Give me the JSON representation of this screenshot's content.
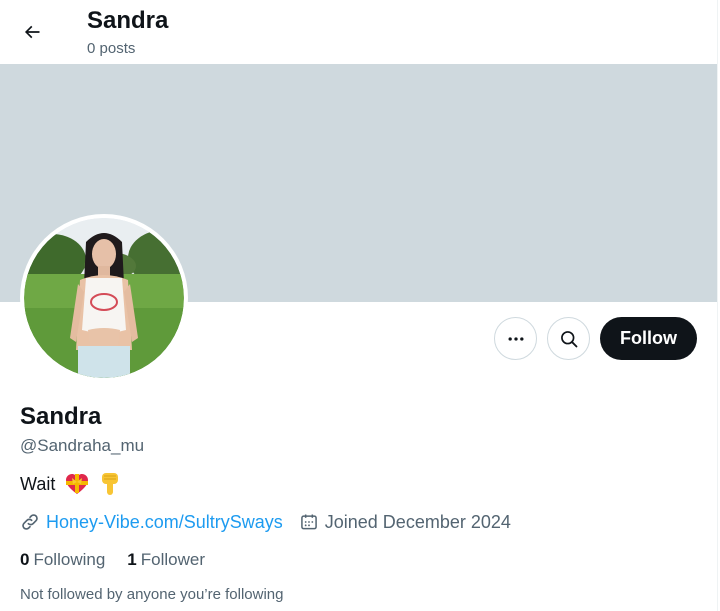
{
  "header": {
    "back_icon": "arrow-left-icon",
    "name": "Sandra",
    "posts": "0 posts"
  },
  "profile": {
    "display_name": "Sandra",
    "handle": "@Sandraha_mu",
    "bio": "Wait",
    "bio_emojis": [
      "heart-with-ribbon-emoji",
      "backhand-index-pointing-down-emoji"
    ],
    "website_icon": "link-icon",
    "website": "Honey-Vibe.com/SultrySways",
    "joined_icon": "calendar-icon",
    "joined": "Joined December 2024",
    "following_count": "0",
    "following_label": "Following",
    "followers_count": "1",
    "followers_label": "Follower",
    "followed_note": "Not followed by anyone you’re following"
  },
  "actions": {
    "more_icon": "more-icon",
    "search_icon": "search-icon",
    "follow_label": "Follow"
  },
  "colors": {
    "banner": "#cfd9de",
    "link": "#1d9bf0",
    "follow_button": "#0f1419",
    "secondary_text": "#536471"
  }
}
